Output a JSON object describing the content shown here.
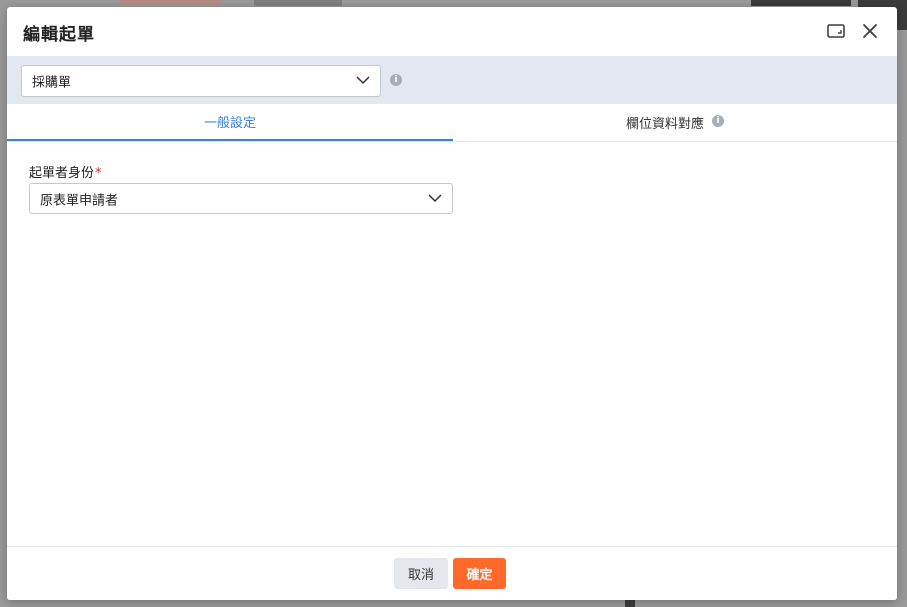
{
  "dialog": {
    "title": "編輯起單"
  },
  "source_select": {
    "value": "採購單"
  },
  "tabs": [
    {
      "label": "一般設定",
      "active": true
    },
    {
      "label": "欄位資料對應",
      "active": false
    }
  ],
  "form": {
    "initiator_label": "起單者身份",
    "required_mark": "*",
    "initiator_value": "原表單申請者"
  },
  "footer": {
    "cancel_label": "取消",
    "confirm_label": "確定"
  },
  "colors": {
    "accent": "#3b82d6",
    "confirm": "#ff6a2b",
    "required": "#e02424"
  }
}
